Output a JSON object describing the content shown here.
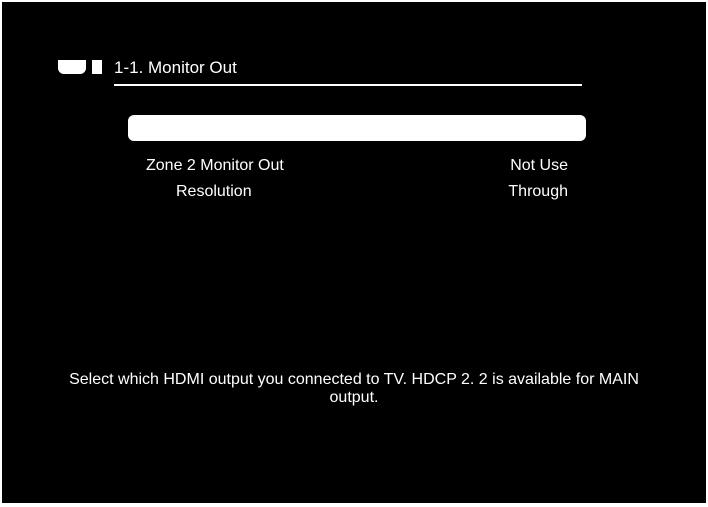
{
  "header": {
    "title": "1-1. Monitor Out"
  },
  "settings": {
    "rows": [
      {
        "label": "Zone 2 Monitor Out",
        "value": "Not Use"
      },
      {
        "label": "Resolution",
        "value": "Through"
      }
    ]
  },
  "help": {
    "text": "Select which HDMI output you connected to TV. HDCP 2. 2 is available for MAIN output."
  }
}
